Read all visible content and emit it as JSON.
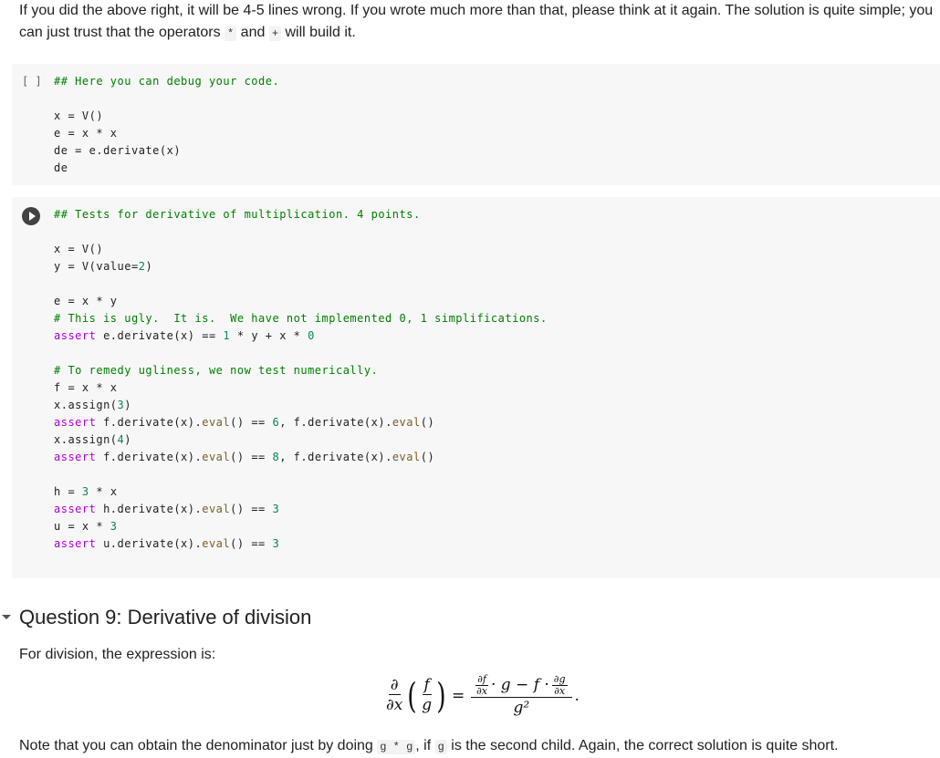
{
  "intro": {
    "line1": "If you did the above right, it will be 4-5 lines wrong. If you wrote much more than that, please think at it again. The solution is quite simple; you",
    "line2_before": "can just trust that the operators ",
    "op1": "*",
    "line2_mid": " and ",
    "op2": "+",
    "line2_after": " will build it."
  },
  "cell1": {
    "brackets": "[ ]",
    "lines": {
      "comment": "## Here you can debug your code.",
      "l1": "x = V()",
      "l2": "e = x * x",
      "l3": "de = e.derivate(x)",
      "l4": "de"
    }
  },
  "cell2": {
    "comment_title": "## Tests for derivative of multiplication. 4 points.",
    "l_x": "x = V()",
    "l_y_pre": "y = V(value=",
    "l_y_num": "2",
    "l_y_post": ")",
    "l_e": "e = x * y",
    "comment_ugly": "# This is ugly.  It is.  We have not implemented 0, 1 simplifications.",
    "assert1_kw": "assert",
    "assert1_mid": " e.derivate(x) == ",
    "assert1_n1": "1",
    "assert1_mid2": " * y + x * ",
    "assert1_n2": "0",
    "comment_remedy": "# To remedy ugliness, we now test numerically.",
    "l_f": "f = x * x",
    "assign1_pre": "x.assign(",
    "assign1_num": "3",
    "assign1_post": ")",
    "assert2_kw": "assert",
    "assert2_a": " f.derivate(x).",
    "eval": "eval",
    "assert2_b": "() == ",
    "assert2_num": "6",
    "assert2_c": ", f.derivate(x).",
    "paren_close": "()",
    "assign2_num": "4",
    "assert3_num": "8",
    "l_h_pre": "h = ",
    "l_h_num": "3",
    "l_h_post": " * x",
    "assert4_a": " h.derivate(x).",
    "assert4_num": "3",
    "l_u_pre": "u = x * ",
    "l_u_num": "3",
    "assert5_a": " u.derivate(x).",
    "assert5_num": "3"
  },
  "section": {
    "title": "Question 9: Derivative of division",
    "para": "For division, the expression is:",
    "formula": {
      "d": "∂",
      "dx": "∂x",
      "f": "f",
      "g": "g",
      "eq": "=",
      "df": "∂f",
      "dg": "∂g",
      "mid": "· g − f ·",
      "g2": "g²",
      "period": "."
    },
    "note_before": "Note that you can obtain the denominator just by doing ",
    "note_code1": "g * g",
    "note_mid": ", if ",
    "note_code2": "g",
    "note_after": " is the second child. Again, the correct solution is quite short."
  }
}
